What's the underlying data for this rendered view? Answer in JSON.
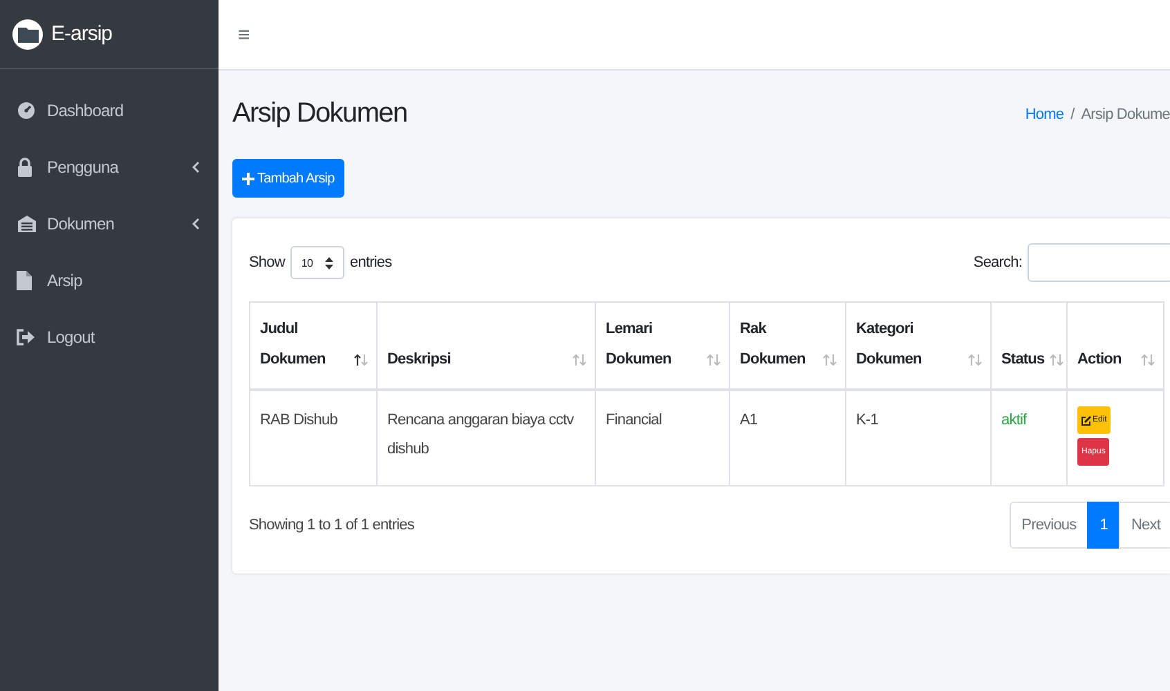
{
  "brand": {
    "title": "E-arsip"
  },
  "sidebar": {
    "items": [
      {
        "label": "Dashboard",
        "kind": "dashboard",
        "has_submenu": false
      },
      {
        "label": "Pengguna",
        "kind": "lock",
        "has_submenu": true
      },
      {
        "label": "Dokumen",
        "kind": "archive",
        "has_submenu": true
      },
      {
        "label": "Arsip",
        "kind": "file",
        "has_submenu": false
      },
      {
        "label": "Logout",
        "kind": "logout",
        "has_submenu": false
      }
    ]
  },
  "topbar": {
    "menu_glyph": "≡"
  },
  "page": {
    "title": "Arsip Dokumen",
    "breadcrumb_separator": "/",
    "breadcrumb": [
      {
        "label": "Home",
        "link": true
      },
      {
        "label": "Arsip Dokume",
        "link": false
      }
    ]
  },
  "add_button": {
    "label": "Tambah Arsip"
  },
  "table": {
    "length_label_before": "Show",
    "length_value": "10",
    "length_label_after": "entries",
    "search_label": "Search:",
    "columns": [
      {
        "label": "Judul Dokumen",
        "sorted": true,
        "kind": "text"
      },
      {
        "label": "Deskripsi",
        "sorted": false,
        "kind": "text"
      },
      {
        "label": "Lemari Dokumen",
        "sorted": false,
        "kind": "text"
      },
      {
        "label": "Rak Dokumen",
        "sorted": false,
        "kind": "text"
      },
      {
        "label": "Kategori Dokumen",
        "sorted": false,
        "kind": "text"
      },
      {
        "label": "Status",
        "sorted": false,
        "kind": "status"
      },
      {
        "label": "Action",
        "sorted": false,
        "kind": "actions"
      }
    ],
    "rows": [
      {
        "cells": [
          "RAB Dishub",
          "Rencana anggaran biaya cctv dishub",
          "Financial",
          "A1",
          "K-1",
          "aktif"
        ],
        "actions": [
          {
            "label": "Edit",
            "kind": "edit"
          },
          {
            "label": "Hapus",
            "kind": "delete"
          }
        ]
      }
    ],
    "info": "Showing 1 to 1 of 1 entries",
    "pagination": [
      {
        "label": "Previous",
        "selected": false
      },
      {
        "label": "1",
        "selected": true
      },
      {
        "label": "Next",
        "selected": false
      }
    ]
  }
}
